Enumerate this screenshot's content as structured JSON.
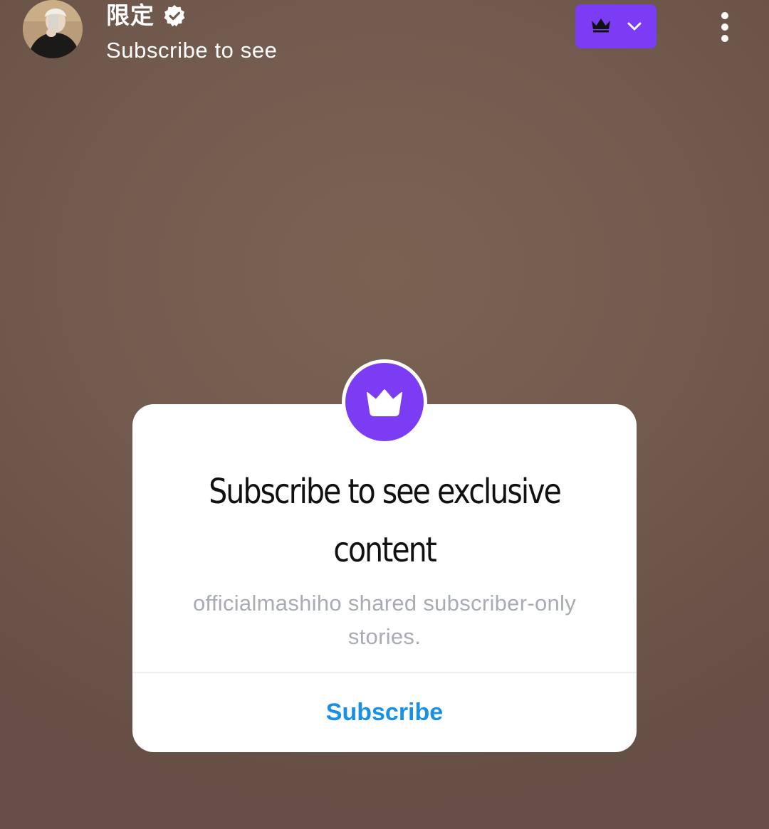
{
  "header": {
    "avatar_icon": "profile-photo",
    "username": "限定",
    "verified_icon": "verified-badge-icon",
    "subtitle": "Subscribe to see",
    "subscription_menu": {
      "crown_icon": "crown-icon",
      "chevron_icon": "chevron-down-icon",
      "color": "#7c3cf4"
    },
    "more_icon": "more-vertical-icon"
  },
  "paywall": {
    "badge_icon": "crown-icon",
    "title": "Subscribe to see exclusive content",
    "description": "officialmashiho shared subscriber-only stories.",
    "action_label": "Subscribe",
    "colors": {
      "accent": "#7c3cf4",
      "action": "#1a8fe6",
      "description": "#a8acb4"
    }
  }
}
